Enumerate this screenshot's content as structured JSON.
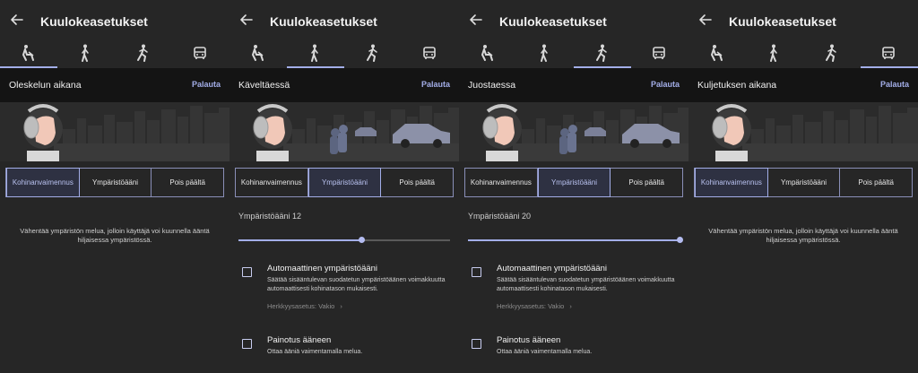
{
  "colors": {
    "accent": "#a3aee8",
    "background": "#262626",
    "modebar": "#141414"
  },
  "panels": [
    {
      "title": "Kuulokeasetukset",
      "active_tab": 0,
      "mode_title": "Oleskelun aikana",
      "reset_label": "Palauta",
      "segments": [
        "Kohinanvaimennus",
        "Ympäristöääni",
        "Pois päältä"
      ],
      "selected_segment": 0,
      "description": "Vähentää ympäristön melua, jolloin käyttäjä voi kuunnella ääntä hiljaisessa ympäristössä."
    },
    {
      "title": "Kuulokeasetukset",
      "active_tab": 1,
      "mode_title": "Käveltäessä",
      "reset_label": "Palauta",
      "segments": [
        "Kohinanvaimennus",
        "Ympäristöääni",
        "Pois päältä"
      ],
      "selected_segment": 1,
      "ambient_label": "Ympäristöääni 12",
      "ambient_level": 0.58,
      "auto_ambient": {
        "title": "Automaattinen ympäristöääni",
        "subtitle": "Säätää sisääntulevan suodatetun ympäristöäänen voimakkuutta automaattisesti kohinatason mukaisesti.",
        "checked": false
      },
      "sensitivity_label": "Herkkyysasetus: Vakio",
      "voice_focus": {
        "title": "Painotus ääneen",
        "subtitle": "Ottaa ääniä vaimentamalla melua.",
        "checked": false
      }
    },
    {
      "title": "Kuulokeasetukset",
      "active_tab": 2,
      "mode_title": "Juostaessa",
      "reset_label": "Palauta",
      "segments": [
        "Kohinanvaimennus",
        "Ympäristöääni",
        "Pois päältä"
      ],
      "selected_segment": 1,
      "ambient_label": "Ympäristöääni 20",
      "ambient_level": 1.0,
      "auto_ambient": {
        "title": "Automaattinen ympäristöääni",
        "subtitle": "Säätää sisääntulevan suodatetun ympäristöäänen voimakkuutta automaattisesti kohinatason mukaisesti.",
        "checked": false
      },
      "sensitivity_label": "Herkkyysasetus: Vakio",
      "voice_focus": {
        "title": "Painotus ääneen",
        "subtitle": "Ottaa ääniä vaimentamalla melua.",
        "checked": false
      }
    },
    {
      "title": "Kuulokeasetukset",
      "active_tab": 3,
      "mode_title": "Kuljetuksen aikana",
      "reset_label": "Palauta",
      "segments": [
        "Kohinanvaimennus",
        "Ympäristöääni",
        "Pois päältä"
      ],
      "selected_segment": 0,
      "description": "Vähentää ympäristön melua, jolloin käyttäjä voi kuunnella ääntä hiljaisessa ympäristössä."
    }
  ],
  "tab_icons": [
    "sitting-person-icon",
    "walking-person-icon",
    "running-person-icon",
    "bus-icon"
  ]
}
